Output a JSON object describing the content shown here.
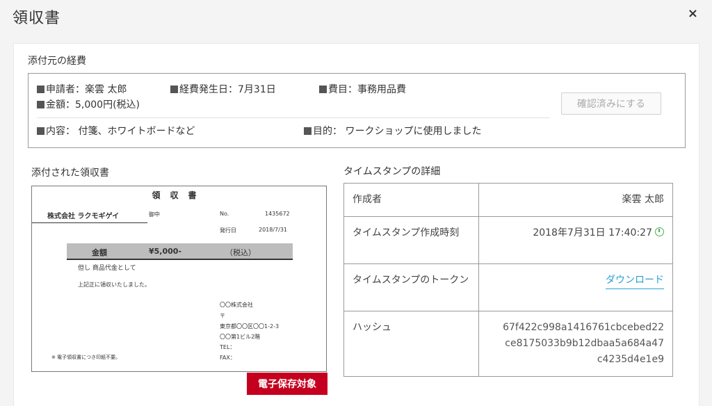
{
  "modal": {
    "title": "領収書",
    "close_label": "×"
  },
  "expense": {
    "section_label": "添付元の経費",
    "applicant": "申請者：楽雲 太郎",
    "date": "経費発生日：7月31日",
    "category": "費目：事務用品費",
    "amount": "金額：5,000円(税込)",
    "content": "内容： 付箋、ホワイトボードなど",
    "purpose": "目的： ワークショップに使用しました",
    "confirm_button": "確認済みにする"
  },
  "receipt": {
    "section_label": "添付された領収書",
    "title": "領収書",
    "company": "株式会社 ラクモギゲイ",
    "onchu": "御中",
    "no_label": "No.",
    "no_value": "1435672",
    "date_label": "発行日",
    "date_value": "2018/7/31",
    "amount_label": "金額",
    "amount_value": "¥5,000-",
    "amount_tax": "（税込）",
    "tadashi": "但し 商品代金として",
    "received": "上記正に領収いたしました。",
    "issuer_lines": [
      "〇〇株式会社",
      "〒",
      "東京都〇〇区〇〇1-2-3",
      "〇〇第1ビル2階",
      "TEL：",
      "FAX："
    ],
    "note": "※ 電子領収書につき印紙不要。",
    "badge": "電子保存対象"
  },
  "timestamp": {
    "section_label": "タイムスタンプの詳細",
    "rows": [
      {
        "key": "作成者",
        "value": "楽雲 太郎"
      },
      {
        "key": "タイムスタンプ作成時刻",
        "value": "2018年7月31日 17:40:27"
      },
      {
        "key": "タイムスタンプのトークン",
        "value": "ダウンロード"
      },
      {
        "key": "ハッシュ",
        "value": [
          "67f422c998a1416761cbcebed22",
          "ce8175033b9b12dbaa5a684a47",
          "c4235d4e1e9"
        ]
      }
    ]
  },
  "colors": {
    "badge": "#c5001e",
    "link": "#2a9fd6",
    "clock": "#4caf50"
  }
}
